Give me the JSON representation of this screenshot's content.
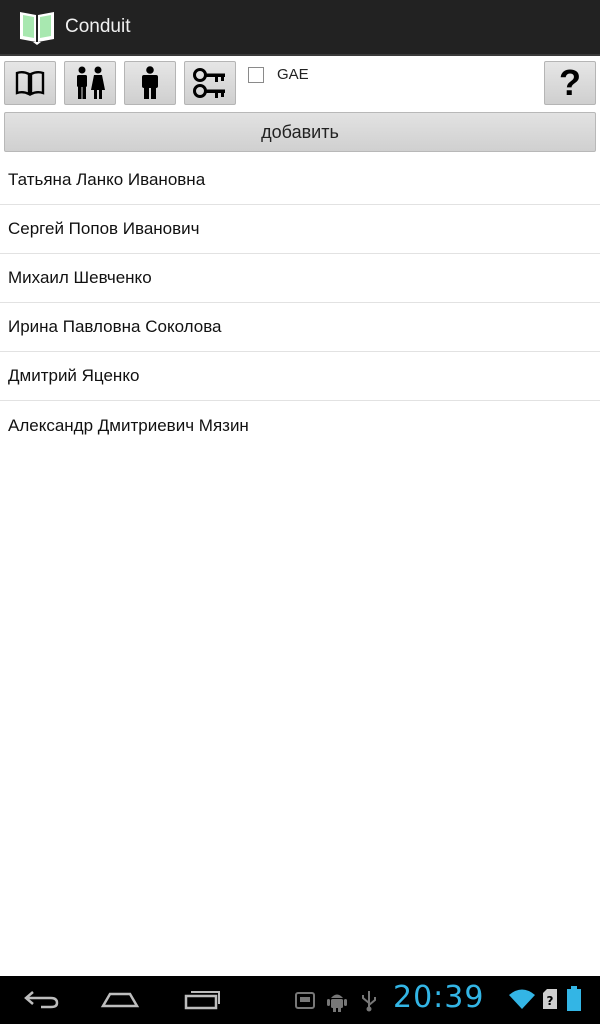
{
  "app": {
    "title": "Conduit",
    "icon": "open-book-icon",
    "icon_color": "#a8e8b0"
  },
  "toolbar": {
    "buttons": [
      {
        "icon": "book-icon"
      },
      {
        "icon": "people-icon"
      },
      {
        "icon": "person-icon"
      },
      {
        "icon": "keys-icon"
      }
    ],
    "gae_label": "GAE",
    "gae_checked": false,
    "help_label": "?"
  },
  "add_button": {
    "label": "добавить"
  },
  "people": [
    "Татьяна Ланко Ивановна",
    "Сергей Попов Иванович",
    "Михаил Шевченко",
    "Ирина Павловна Соколова",
    "Дмитрий Яценко",
    "Александр Дмитриевич Мязин"
  ],
  "navbar": {
    "clock": "20:39",
    "clock_color": "#33b5e5",
    "icons": [
      "back-icon",
      "home-icon",
      "recent-apps-icon",
      "sd-card-icon",
      "android-debug-icon",
      "usb-icon",
      "wifi-icon",
      "no-sim-icon",
      "battery-icon"
    ]
  }
}
